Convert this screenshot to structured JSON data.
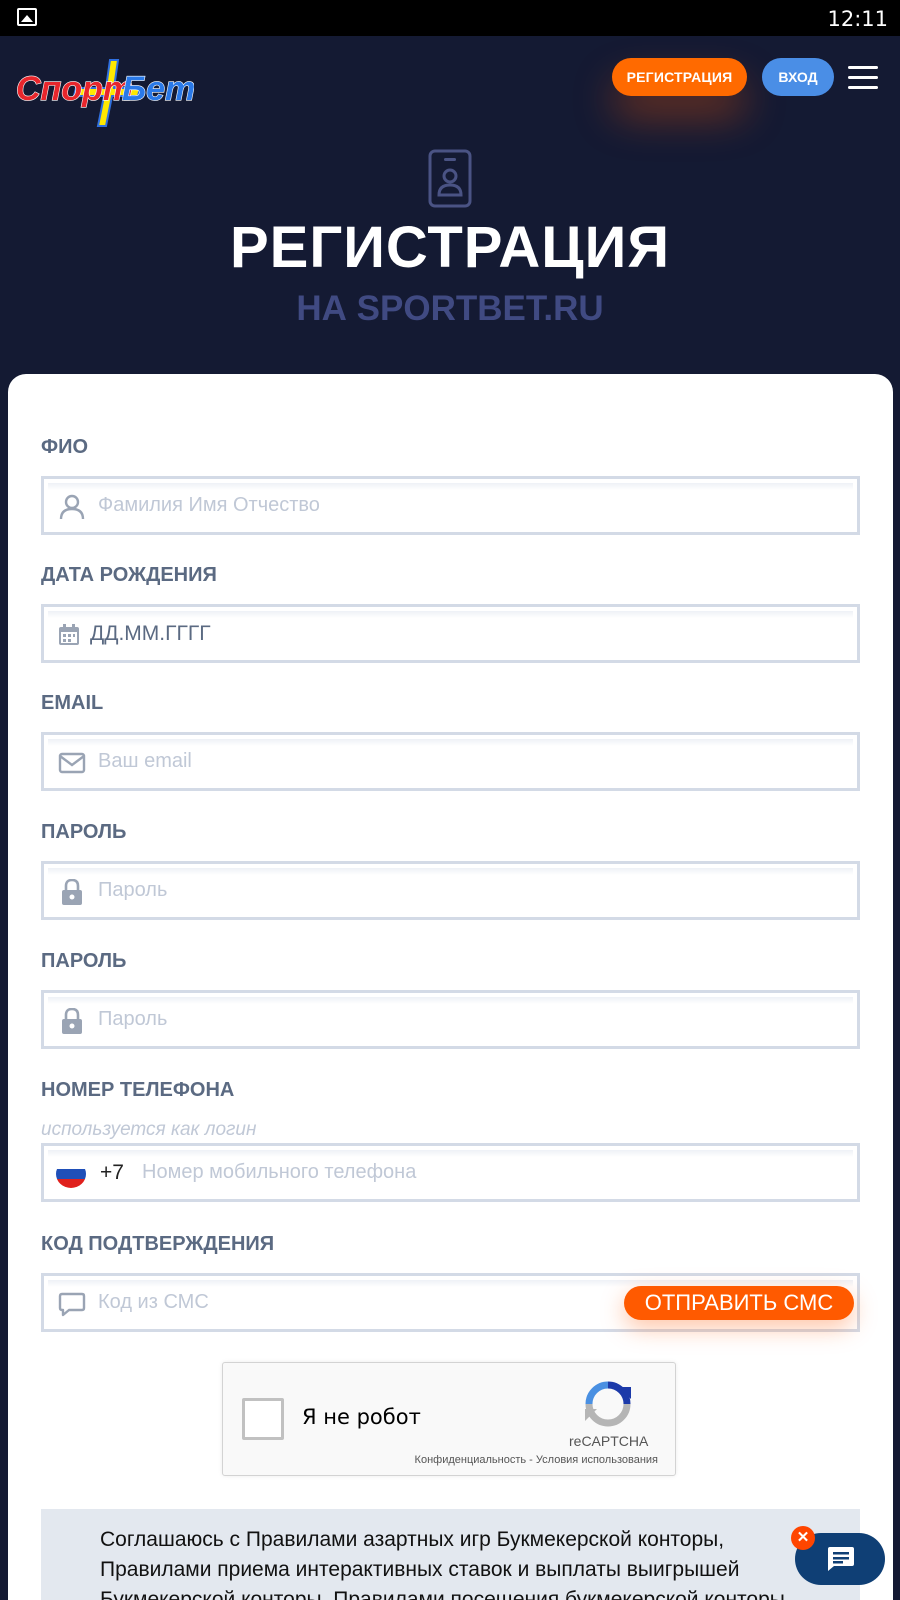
{
  "status_bar": {
    "time": "12:11"
  },
  "header": {
    "logo_text": "СпортБет",
    "register_button": "РЕГИСТРАЦИЯ",
    "login_button": "ВХОД"
  },
  "hero": {
    "title": "РЕГИСТРАЦИЯ",
    "subtitle": "НА SPORTBET.RU"
  },
  "form": {
    "fio": {
      "label": "ФИО",
      "placeholder": "Фамилия Имя Отчество"
    },
    "birthdate": {
      "label": "ДАТА РОЖДЕНИЯ",
      "value": "ДД.ММ.ГГГГ"
    },
    "email": {
      "label": "EMAIL",
      "placeholder": "Ваш email"
    },
    "password": {
      "label": "ПАРОЛЬ",
      "placeholder": "Пароль"
    },
    "password_confirm": {
      "label": "ПАРОЛЬ",
      "placeholder": "Пароль"
    },
    "phone": {
      "label": "НОМЕР ТЕЛЕФОНА",
      "hint": "используется как логин",
      "prefix": "+7",
      "placeholder": "Номер мобильного телефона"
    },
    "code": {
      "label": "КОД ПОДТВЕРЖДЕНИЯ",
      "placeholder": "Код из СМС",
      "send_button": "ОТПРАВИТЬ СМС"
    }
  },
  "captcha": {
    "text": "Я не робот",
    "brand": "reCAPTCHA",
    "links": "Конфиденциальность - Условия использования"
  },
  "agreement": {
    "text": "Соглашаюсь с Правилами азартных игр Букмекерской конторы, Правилами приема интерактивных ставок и выплаты выигрышей Букмекерской конторы, Правилами посещения букмекерской конторы"
  },
  "chat_widget": {
    "close_symbol": "✕"
  },
  "colors": {
    "header_bg": "#141a33",
    "accent_orange": "#ff6a00",
    "login_blue": "#4a8ee6",
    "label_gray": "#5b6a82",
    "chat_navy": "#0f3f75"
  },
  "icons": [
    "image-icon",
    "menu-icon",
    "id-card-icon",
    "user-icon",
    "calendar-icon",
    "mail-icon",
    "lock-icon",
    "russia-flag-icon",
    "chat-bubble-icon",
    "chat-icon",
    "recaptcha-icon",
    "close-icon"
  ]
}
